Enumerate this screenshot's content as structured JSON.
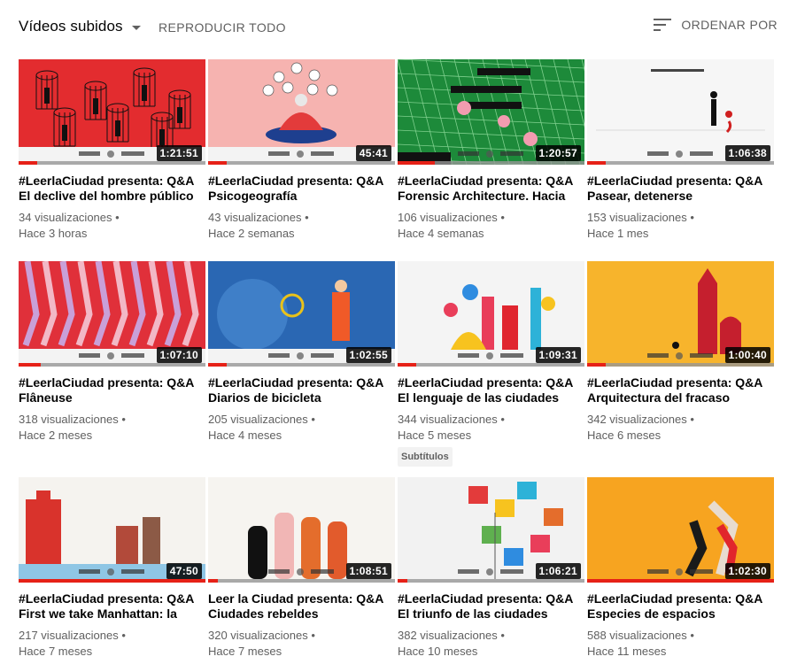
{
  "header": {
    "sort_selector_label": "Vídeos subidos",
    "play_all_label": "REPRODUCIR TODO",
    "sort_by_label": "ORDENAR POR"
  },
  "videos": [
    {
      "title": "#LeerlaCiudad presenta: Q&A El declive del hombre público",
      "views": "34 visualizaciones",
      "age": "Hace 3 horas",
      "duration": "1:21:51",
      "watched": 0.1,
      "thumb_bg": "#e32c2f",
      "thumb_caption": "El declive del hombre público"
    },
    {
      "title": "#LeerlaCiudad presenta: Q&A Psicogeografía",
      "views": "43 visualizaciones",
      "age": "Hace 2 semanas",
      "duration": "45:41",
      "watched": 0.1,
      "thumb_bg": "#f6b3b0",
      "thumb_caption": "Psicogeografía"
    },
    {
      "title": "#LeerlaCiudad presenta: Q&A Forensic Architecture. Hacia una estética de las investigaciones",
      "views": "106 visualizaciones",
      "age": "Hace 4 semanas",
      "duration": "1:20:57",
      "watched": 0.2,
      "thumb_bg": "#1d8a3a",
      "thumb_caption": ""
    },
    {
      "title": "#LeerlaCiudad presenta: Q&A Pasear, detenerse",
      "views": "153 visualizaciones",
      "age": "Hace 1 mes",
      "duration": "1:06:38",
      "watched": 0.1,
      "thumb_bg": "#f6f6f6",
      "thumb_caption": "Pasear, detenerse"
    },
    {
      "title": "#LeerlaCiudad presenta: Q&A Flâneuse",
      "views": "318 visualizaciones",
      "age": "Hace 2 meses",
      "duration": "1:07:10",
      "watched": 0.12,
      "thumb_bg": "#e0303a",
      "thumb_caption": ""
    },
    {
      "title": "#LeerlaCiudad presenta: Q&A Diarios de bicicleta",
      "views": "205 visualizaciones",
      "age": "Hace 4 meses",
      "duration": "1:02:55",
      "watched": 0.1,
      "thumb_bg": "#2a67b3",
      "thumb_caption": "Diarios de bicicleta"
    },
    {
      "title": "#LeerlaCiudad presenta: Q&A El lenguaje de las ciudades",
      "views": "344 visualizaciones",
      "age": "Hace 5 meses",
      "duration": "1:09:31",
      "watched": 0.1,
      "badge": "Subtítulos",
      "thumb_bg": "#f4f4f4",
      "thumb_caption": "El lenguaje de las ciudades"
    },
    {
      "title": "#LeerlaCiudad presenta: Q&A Arquitectura del fracaso",
      "views": "342 visualizaciones",
      "age": "Hace 6 meses",
      "duration": "1:00:40",
      "watched": 0.1,
      "thumb_bg": "#f7b42c",
      "thumb_caption": "Arquitectura del fracaso"
    },
    {
      "title": "#LeerlaCiudad presenta: Q&A First we take Manhattan: la destructiva voluntad de progreso",
      "views": "217 visualizaciones",
      "age": "Hace 7 meses",
      "duration": "47:50",
      "watched": 1,
      "thumb_bg": "#f5f3ef",
      "thumb_caption": "First we take Manhattan"
    },
    {
      "title": "Leer la Ciudad presenta: Q&A Ciudades rebeldes",
      "views": "320 visualizaciones",
      "age": "Hace 7 meses",
      "duration": "1:08:51",
      "watched": 0.05,
      "thumb_bg": "#f6f4f0",
      "thumb_caption": "Ciudades rebeldes"
    },
    {
      "title": "#LeerlaCiudad presenta: Q&A El triunfo de las ciudades",
      "views": "382 visualizaciones",
      "age": "Hace 10 meses",
      "duration": "1:06:21",
      "watched": 0.05,
      "thumb_bg": "#f2f2f2",
      "thumb_caption": "El triunfo de las ciudades"
    },
    {
      "title": "#LeerlaCiudad presenta: Q&A Especies de espacios",
      "views": "588 visualizaciones",
      "age": "Hace 11 meses",
      "duration": "1:02:30",
      "watched": 1,
      "thumb_bg": "#f7a420",
      "thumb_caption": "Especies de espacios"
    }
  ]
}
